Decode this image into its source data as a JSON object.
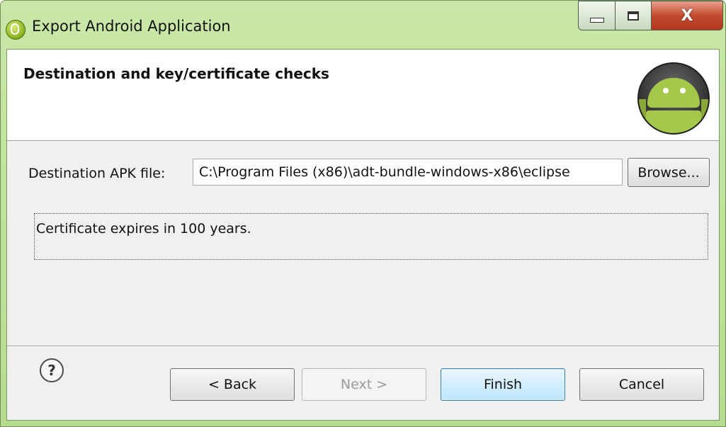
{
  "window": {
    "title": "Export Android Application",
    "close_glyph": "X"
  },
  "banner": {
    "title": "Destination and key/certificate checks",
    "icon": "android-icon"
  },
  "form": {
    "destination_label": "Destination APK file:",
    "destination_value": "C:\\Program Files (x86)\\adt-bundle-windows-x86\\eclipse",
    "browse_label": "Browse...",
    "message": "Certificate expires in 100 years."
  },
  "footer": {
    "help_glyph": "?",
    "back_label": "< Back",
    "next_label": "Next >",
    "finish_label": "Finish",
    "cancel_label": "Cancel"
  },
  "colors": {
    "title_bar": "#b5dc8f",
    "close_button": "#c24a2e",
    "default_button_border": "#3c7fb1"
  }
}
